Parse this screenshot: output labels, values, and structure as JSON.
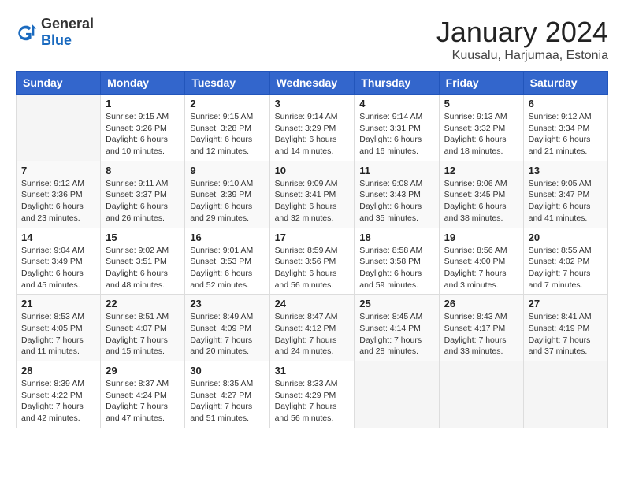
{
  "logo": {
    "general": "General",
    "blue": "Blue"
  },
  "header": {
    "month": "January 2024",
    "location": "Kuusalu, Harjumaa, Estonia"
  },
  "weekdays": [
    "Sunday",
    "Monday",
    "Tuesday",
    "Wednesday",
    "Thursday",
    "Friday",
    "Saturday"
  ],
  "weeks": [
    [
      {
        "day": "",
        "sunrise": "",
        "sunset": "",
        "daylight": ""
      },
      {
        "day": "1",
        "sunrise": "Sunrise: 9:15 AM",
        "sunset": "Sunset: 3:26 PM",
        "daylight": "Daylight: 6 hours and 10 minutes."
      },
      {
        "day": "2",
        "sunrise": "Sunrise: 9:15 AM",
        "sunset": "Sunset: 3:28 PM",
        "daylight": "Daylight: 6 hours and 12 minutes."
      },
      {
        "day": "3",
        "sunrise": "Sunrise: 9:14 AM",
        "sunset": "Sunset: 3:29 PM",
        "daylight": "Daylight: 6 hours and 14 minutes."
      },
      {
        "day": "4",
        "sunrise": "Sunrise: 9:14 AM",
        "sunset": "Sunset: 3:31 PM",
        "daylight": "Daylight: 6 hours and 16 minutes."
      },
      {
        "day": "5",
        "sunrise": "Sunrise: 9:13 AM",
        "sunset": "Sunset: 3:32 PM",
        "daylight": "Daylight: 6 hours and 18 minutes."
      },
      {
        "day": "6",
        "sunrise": "Sunrise: 9:12 AM",
        "sunset": "Sunset: 3:34 PM",
        "daylight": "Daylight: 6 hours and 21 minutes."
      }
    ],
    [
      {
        "day": "7",
        "sunrise": "Sunrise: 9:12 AM",
        "sunset": "Sunset: 3:36 PM",
        "daylight": "Daylight: 6 hours and 23 minutes."
      },
      {
        "day": "8",
        "sunrise": "Sunrise: 9:11 AM",
        "sunset": "Sunset: 3:37 PM",
        "daylight": "Daylight: 6 hours and 26 minutes."
      },
      {
        "day": "9",
        "sunrise": "Sunrise: 9:10 AM",
        "sunset": "Sunset: 3:39 PM",
        "daylight": "Daylight: 6 hours and 29 minutes."
      },
      {
        "day": "10",
        "sunrise": "Sunrise: 9:09 AM",
        "sunset": "Sunset: 3:41 PM",
        "daylight": "Daylight: 6 hours and 32 minutes."
      },
      {
        "day": "11",
        "sunrise": "Sunrise: 9:08 AM",
        "sunset": "Sunset: 3:43 PM",
        "daylight": "Daylight: 6 hours and 35 minutes."
      },
      {
        "day": "12",
        "sunrise": "Sunrise: 9:06 AM",
        "sunset": "Sunset: 3:45 PM",
        "daylight": "Daylight: 6 hours and 38 minutes."
      },
      {
        "day": "13",
        "sunrise": "Sunrise: 9:05 AM",
        "sunset": "Sunset: 3:47 PM",
        "daylight": "Daylight: 6 hours and 41 minutes."
      }
    ],
    [
      {
        "day": "14",
        "sunrise": "Sunrise: 9:04 AM",
        "sunset": "Sunset: 3:49 PM",
        "daylight": "Daylight: 6 hours and 45 minutes."
      },
      {
        "day": "15",
        "sunrise": "Sunrise: 9:02 AM",
        "sunset": "Sunset: 3:51 PM",
        "daylight": "Daylight: 6 hours and 48 minutes."
      },
      {
        "day": "16",
        "sunrise": "Sunrise: 9:01 AM",
        "sunset": "Sunset: 3:53 PM",
        "daylight": "Daylight: 6 hours and 52 minutes."
      },
      {
        "day": "17",
        "sunrise": "Sunrise: 8:59 AM",
        "sunset": "Sunset: 3:56 PM",
        "daylight": "Daylight: 6 hours and 56 minutes."
      },
      {
        "day": "18",
        "sunrise": "Sunrise: 8:58 AM",
        "sunset": "Sunset: 3:58 PM",
        "daylight": "Daylight: 6 hours and 59 minutes."
      },
      {
        "day": "19",
        "sunrise": "Sunrise: 8:56 AM",
        "sunset": "Sunset: 4:00 PM",
        "daylight": "Daylight: 7 hours and 3 minutes."
      },
      {
        "day": "20",
        "sunrise": "Sunrise: 8:55 AM",
        "sunset": "Sunset: 4:02 PM",
        "daylight": "Daylight: 7 hours and 7 minutes."
      }
    ],
    [
      {
        "day": "21",
        "sunrise": "Sunrise: 8:53 AM",
        "sunset": "Sunset: 4:05 PM",
        "daylight": "Daylight: 7 hours and 11 minutes."
      },
      {
        "day": "22",
        "sunrise": "Sunrise: 8:51 AM",
        "sunset": "Sunset: 4:07 PM",
        "daylight": "Daylight: 7 hours and 15 minutes."
      },
      {
        "day": "23",
        "sunrise": "Sunrise: 8:49 AM",
        "sunset": "Sunset: 4:09 PM",
        "daylight": "Daylight: 7 hours and 20 minutes."
      },
      {
        "day": "24",
        "sunrise": "Sunrise: 8:47 AM",
        "sunset": "Sunset: 4:12 PM",
        "daylight": "Daylight: 7 hours and 24 minutes."
      },
      {
        "day": "25",
        "sunrise": "Sunrise: 8:45 AM",
        "sunset": "Sunset: 4:14 PM",
        "daylight": "Daylight: 7 hours and 28 minutes."
      },
      {
        "day": "26",
        "sunrise": "Sunrise: 8:43 AM",
        "sunset": "Sunset: 4:17 PM",
        "daylight": "Daylight: 7 hours and 33 minutes."
      },
      {
        "day": "27",
        "sunrise": "Sunrise: 8:41 AM",
        "sunset": "Sunset: 4:19 PM",
        "daylight": "Daylight: 7 hours and 37 minutes."
      }
    ],
    [
      {
        "day": "28",
        "sunrise": "Sunrise: 8:39 AM",
        "sunset": "Sunset: 4:22 PM",
        "daylight": "Daylight: 7 hours and 42 minutes."
      },
      {
        "day": "29",
        "sunrise": "Sunrise: 8:37 AM",
        "sunset": "Sunset: 4:24 PM",
        "daylight": "Daylight: 7 hours and 47 minutes."
      },
      {
        "day": "30",
        "sunrise": "Sunrise: 8:35 AM",
        "sunset": "Sunset: 4:27 PM",
        "daylight": "Daylight: 7 hours and 51 minutes."
      },
      {
        "day": "31",
        "sunrise": "Sunrise: 8:33 AM",
        "sunset": "Sunset: 4:29 PM",
        "daylight": "Daylight: 7 hours and 56 minutes."
      },
      {
        "day": "",
        "sunrise": "",
        "sunset": "",
        "daylight": ""
      },
      {
        "day": "",
        "sunrise": "",
        "sunset": "",
        "daylight": ""
      },
      {
        "day": "",
        "sunrise": "",
        "sunset": "",
        "daylight": ""
      }
    ]
  ]
}
